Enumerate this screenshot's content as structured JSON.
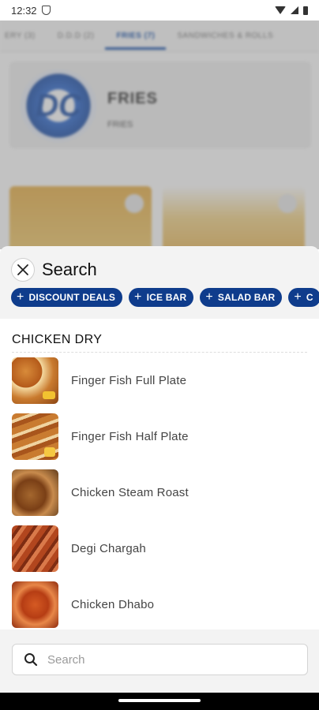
{
  "status_bar": {
    "time": "12:32",
    "icons": [
      "shield-icon",
      "wifi-icon",
      "signal-icon",
      "battery-icon"
    ]
  },
  "background": {
    "tabs": [
      "ERY (3)",
      "D.D.D (2)",
      "FRIES (7)",
      "SANDWICHES & ROLLS"
    ],
    "active_tab_index": 2,
    "category_title": "FRIES",
    "category_subtitle": "FRIES",
    "logo_text": "DC"
  },
  "search_sheet": {
    "title": "Search",
    "chips": [
      "DISCOUNT DEALS",
      "ICE BAR",
      "SALAD BAR",
      "C"
    ],
    "section": {
      "title": "CHICKEN DRY",
      "items": [
        {
          "name": "Finger Fish Full Plate"
        },
        {
          "name": "Finger Fish Half Plate"
        },
        {
          "name": "Chicken Steam Roast"
        },
        {
          "name": "Degi Chargah"
        },
        {
          "name": "Chicken Dhabo"
        }
      ]
    },
    "search_input": {
      "value": "",
      "placeholder": "Search"
    }
  },
  "colors": {
    "accent": "#0f3c8c",
    "chip_text": "#ffffff",
    "sheet_bg": "#f3f3f3"
  }
}
